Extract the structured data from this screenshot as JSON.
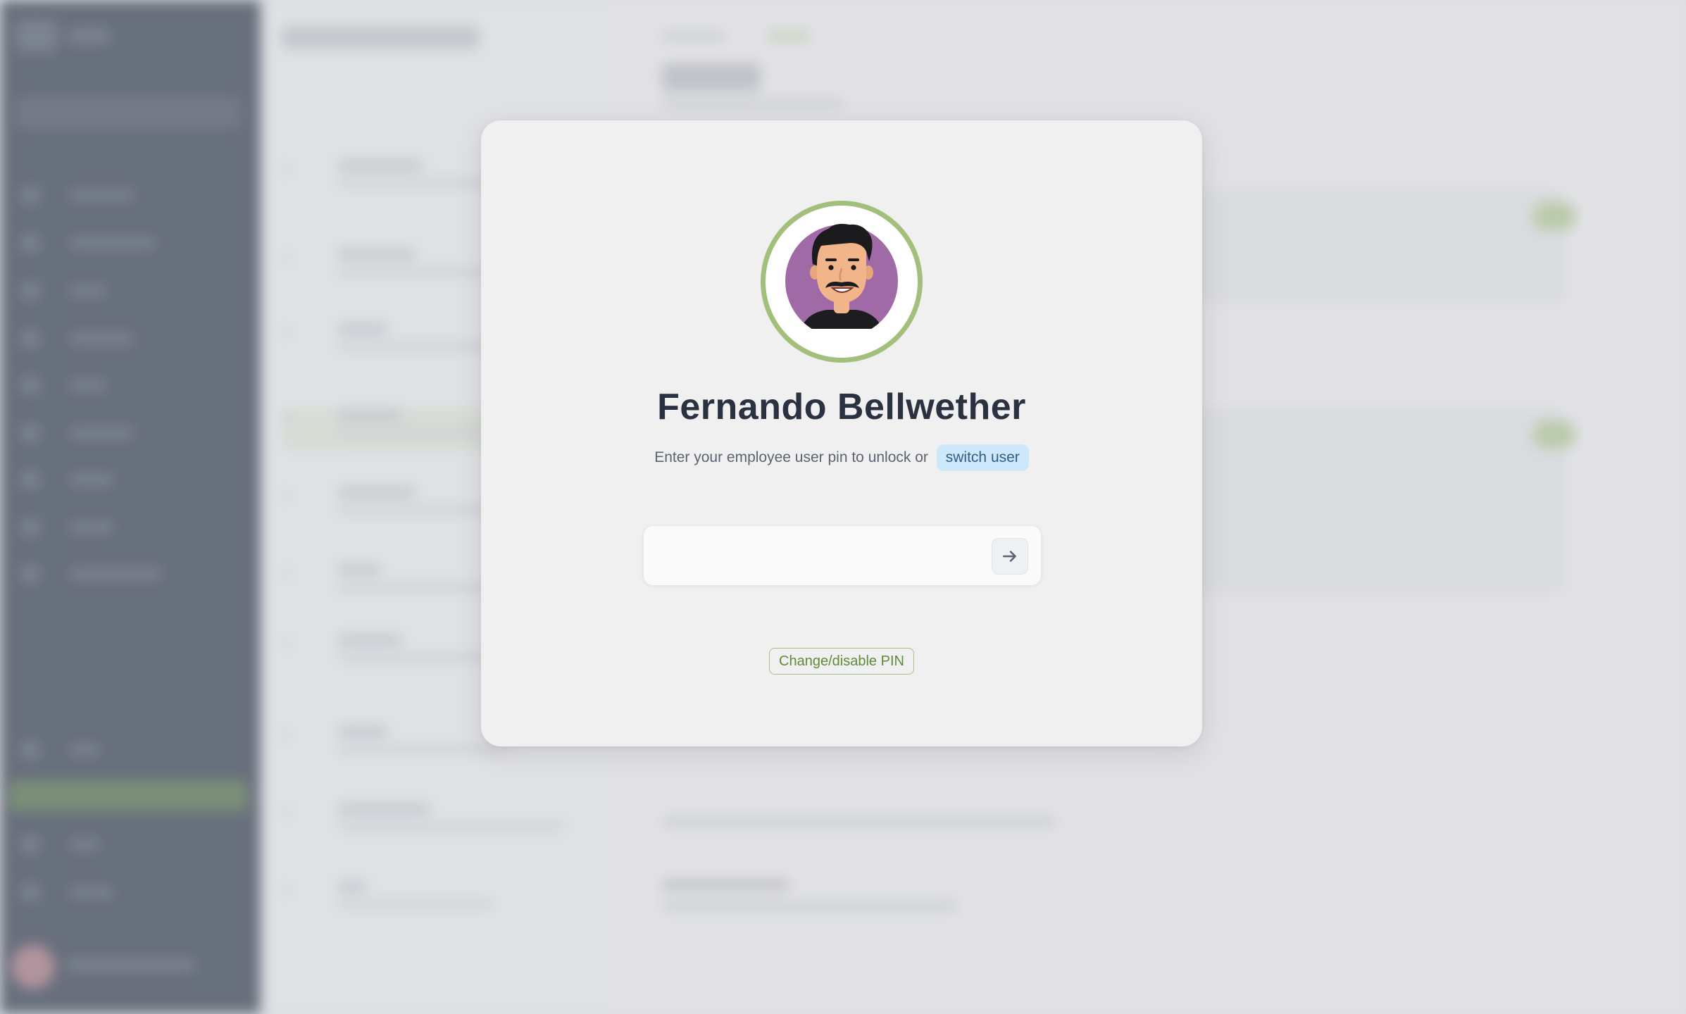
{
  "lock_screen": {
    "user_name": "Fernando Bellwether",
    "instruction": "Enter your employee user pin to unlock or",
    "switch_user_label": "switch user",
    "pin_input": {
      "value": "",
      "placeholder": ""
    },
    "submit_icon": "arrow-right-icon",
    "change_pin_label": "Change/disable PIN",
    "avatar_ring_color": "#a2bf7c",
    "avatar_background_color": "#a06aa6"
  },
  "colors": {
    "sidebar": "#2b3647",
    "accent_green": "#5f8a3b",
    "switch_user_bg": "#cde8fb"
  }
}
